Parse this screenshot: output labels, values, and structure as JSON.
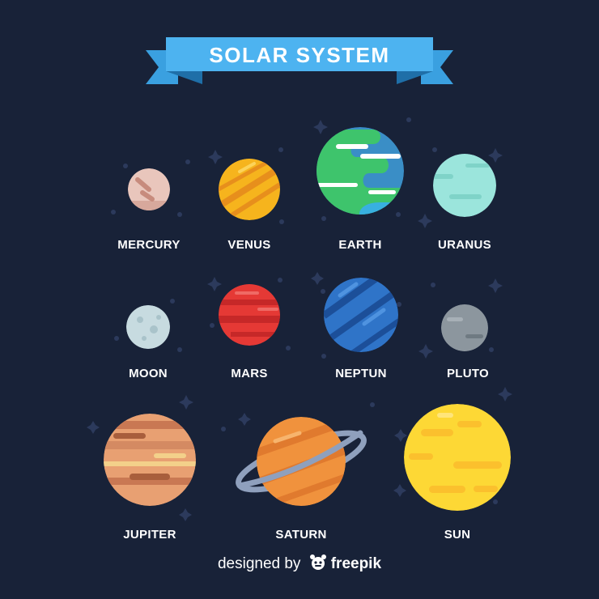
{
  "title": "SOLAR SYSTEM",
  "planets": {
    "mercury": "MERCURY",
    "venus": "VENUS",
    "earth": "EARTH",
    "uranus": "URANUS",
    "moon": "MOON",
    "mars": "MARS",
    "neptun": "NEPTUN",
    "pluto": "PLUTO",
    "jupiter": "JUPITER",
    "saturn": "SATURN",
    "sun": "SUN"
  },
  "credit": {
    "prefix": "designed by",
    "brand": "freepik",
    "logo_icon": "freepik-logo-icon"
  },
  "colors": {
    "background": "#182238",
    "banner": "#4db3f0",
    "banner_dark": "#2a88c8"
  }
}
